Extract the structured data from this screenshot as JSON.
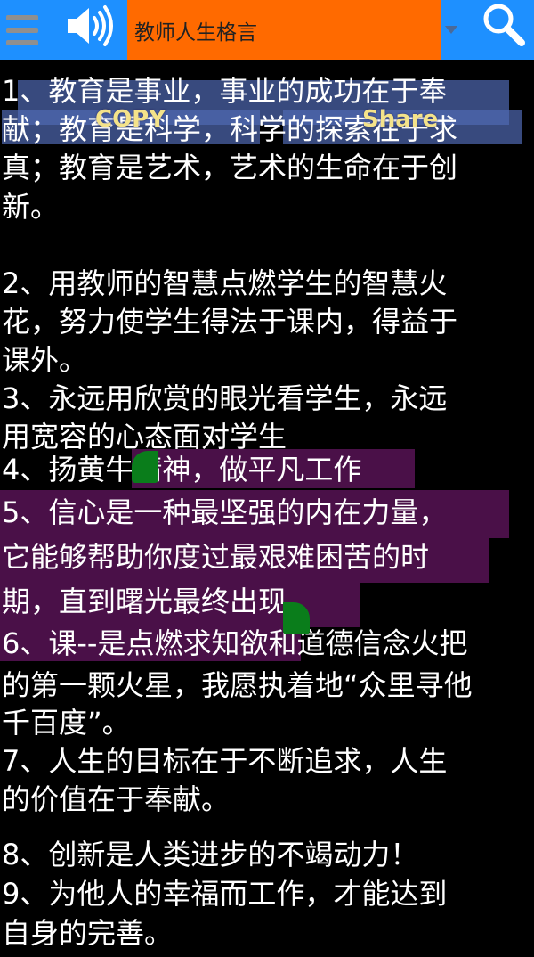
{
  "toolbar": {
    "title": "教师人生格言",
    "icons": {
      "menu": "hamburger-menu-icon",
      "speaker": "speaker-icon",
      "dropdown": "dropdown-arrow-icon",
      "search": "search-icon"
    },
    "colors": {
      "bar_bg": "#1e90ff",
      "title_bg": "#ff6a00"
    }
  },
  "context_menu": {
    "copy_label": "COPY",
    "share_label": "Share"
  },
  "colors": {
    "page_bg": "#000000",
    "text": "#ffffff",
    "selection_blue": "#5069b4",
    "selection_purple": "#4a1048",
    "handle": "#0a7d1b",
    "context_label": "#f4e38a"
  },
  "lines": [
    "1、教育是事业，事业的成功在于奉",
    "献；教育是科学，科学的探索在于求",
    "真；教育是艺术，艺术的生命在于创",
    "新。",
    "",
    "2、用教师的智慧点燃学生的智慧火",
    "花，努力使学生得法于课内，得益于",
    "课外。",
    "3、永远用欣赏的眼光看学生，永远",
    "用宽容的心态面对学生",
    "4、扬黄牛精神，做平凡工作",
    "5、信心是一种最坚强的内在力量，",
    "它能够帮助你度过最艰难困苦的时",
    "期，直到曙光最终出现。",
    "6、课--是点燃求知欲和道德信念火把",
    "的第一颗火星，我愿执着地“众里寻他",
    "千百度”。",
    "7、人生的目标在于不断追求，人生",
    "的价值在于奉献。",
    "",
    "8、创新是人类进步的不竭动力！",
    "9、为他人的幸福而工作，才能达到",
    "自身的完善。"
  ]
}
